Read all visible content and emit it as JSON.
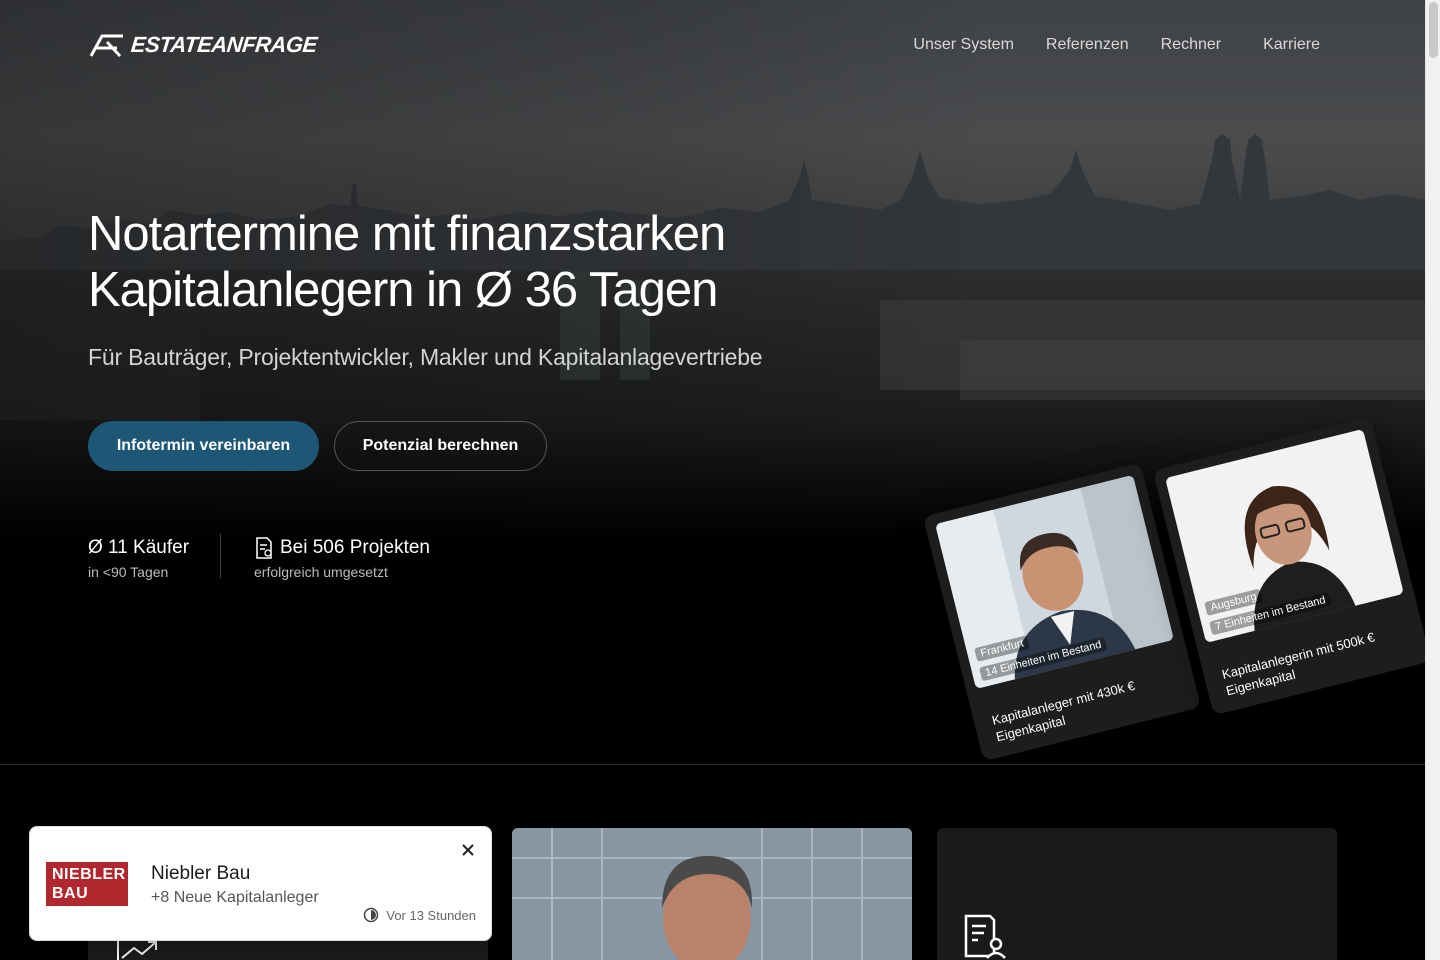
{
  "brand": {
    "name": "ESTATEANFRAGE",
    "logo_icon": "estateanfrage-logo-icon"
  },
  "nav": {
    "items": [
      {
        "label": "Unser System"
      },
      {
        "label": "Referenzen"
      },
      {
        "label": "Rechner"
      },
      {
        "label": "Karriere"
      }
    ]
  },
  "hero": {
    "headline_line1": "Notartermine mit finanzstarken",
    "headline_line2": "Kapitalanlegern in Ø 36 Tagen",
    "subheadline": "Für Bauträger, Projektentwickler, Makler und Kapitalanlagevertriebe",
    "cta_primary": "Infotermin vereinbaren",
    "cta_secondary": "Potenzial berechnen",
    "primary_color": "#1d5775"
  },
  "stats": [
    {
      "main": "Ø 11 Käufer",
      "sub": "in <90 Tagen"
    },
    {
      "main": "Bei 506 Projekten",
      "sub": "erfolgreich umgesetzt",
      "icon": "document-icon"
    }
  ],
  "profiles": [
    {
      "location": "Frankfurt",
      "units": "14 Einheiten im Bestand",
      "description": "Kapitalanleger mit 430k € Eigenkapital"
    },
    {
      "location": "Augsburg",
      "units": "7 Einheiten im Bestand",
      "description": "Kapitalanlegerin mit 500k € Eigenkapital"
    }
  ],
  "notification": {
    "logo_line1": "NIEBLER",
    "logo_line2": "BAU",
    "title": "Niebler Bau",
    "subtitle": "+8 Neue Kapitalanleger",
    "time": "Vor 13 Stunden",
    "logo_color": "#b0282e"
  }
}
